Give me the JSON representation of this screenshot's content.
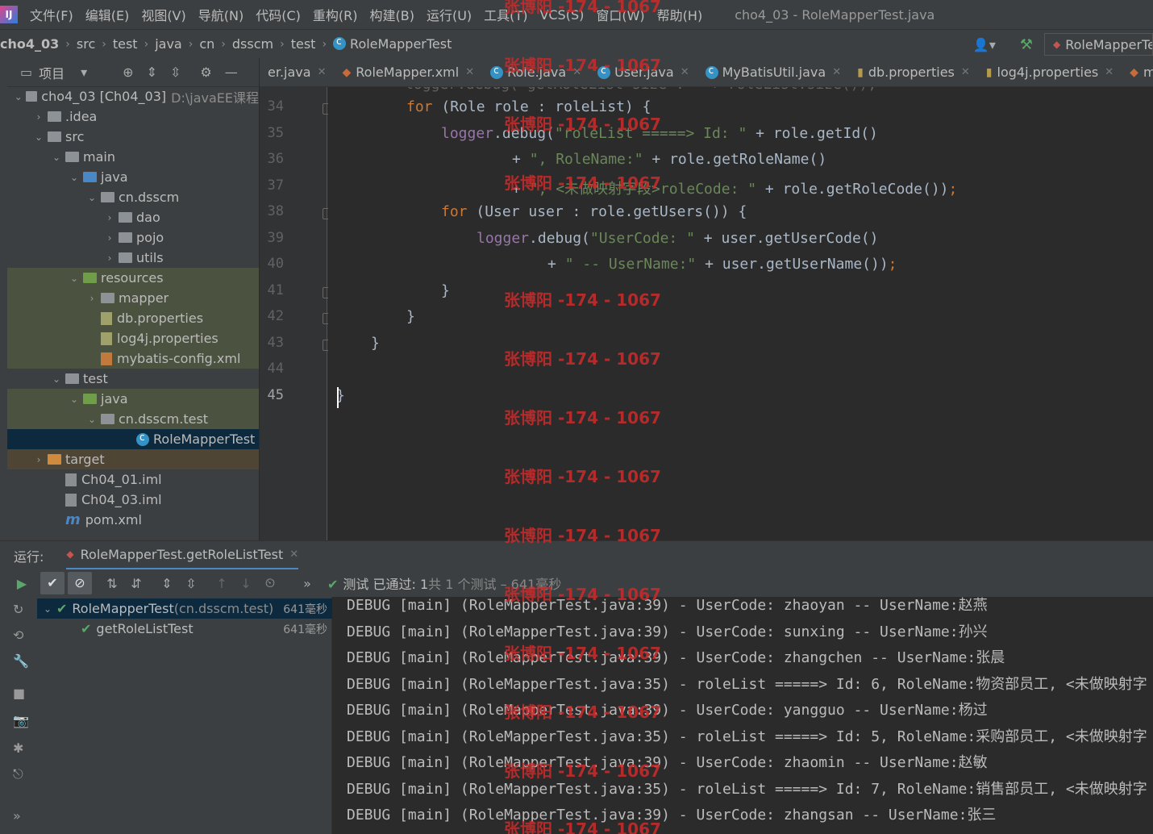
{
  "menubar": {
    "logo": "IJ",
    "items": [
      "文件(F)",
      "编辑(E)",
      "视图(V)",
      "导航(N)",
      "代码(C)",
      "重构(R)",
      "构建(B)",
      "运行(U)",
      "工具(T)",
      "VCS(S)",
      "窗口(W)",
      "帮助(H)"
    ],
    "window_title": "cho4_03 - RoleMapperTest.java"
  },
  "breadcrumb": [
    "cho4_03",
    "src",
    "test",
    "java",
    "cn",
    "dsscm",
    "test",
    "RoleMapperTest"
  ],
  "nav_right": {
    "run_config": "RoleMapperTest"
  },
  "project_panel": {
    "title": "项目",
    "tree": [
      {
        "label": "cho4_03 [Ch04_03]",
        "extra": "D:\\javaEE课程",
        "indent": 0,
        "twist": "⌄",
        "icon": "folder",
        "style": ""
      },
      {
        "label": ".idea",
        "indent": 1,
        "twist": "›",
        "icon": "folder",
        "style": ""
      },
      {
        "label": "src",
        "indent": 1,
        "twist": "⌄",
        "icon": "folder",
        "style": ""
      },
      {
        "label": "main",
        "indent": 2,
        "twist": "⌄",
        "icon": "folder",
        "style": ""
      },
      {
        "label": "java",
        "indent": 3,
        "twist": "⌄",
        "icon": "folder blue",
        "style": ""
      },
      {
        "label": "cn.dsscm",
        "indent": 4,
        "twist": "⌄",
        "icon": "folder",
        "style": ""
      },
      {
        "label": "dao",
        "indent": 5,
        "twist": "›",
        "icon": "folder",
        "style": ""
      },
      {
        "label": "pojo",
        "indent": 5,
        "twist": "›",
        "icon": "folder",
        "style": ""
      },
      {
        "label": "utils",
        "indent": 5,
        "twist": "›",
        "icon": "folder",
        "style": ""
      },
      {
        "label": "resources",
        "indent": 3,
        "twist": "⌄",
        "icon": "folder green",
        "style": "hl"
      },
      {
        "label": "mapper",
        "indent": 4,
        "twist": "›",
        "icon": "folder",
        "style": "hl"
      },
      {
        "label": "db.properties",
        "indent": 4,
        "twist": "",
        "icon": "file-ic prop",
        "style": "hl"
      },
      {
        "label": "log4j.properties",
        "indent": 4,
        "twist": "",
        "icon": "file-ic prop",
        "style": "hl"
      },
      {
        "label": "mybatis-config.xml",
        "indent": 4,
        "twist": "",
        "icon": "file-ic xml",
        "style": "hl"
      },
      {
        "label": "test",
        "indent": 2,
        "twist": "⌄",
        "icon": "folder",
        "style": ""
      },
      {
        "label": "java",
        "indent": 3,
        "twist": "⌄",
        "icon": "folder green",
        "style": "hl"
      },
      {
        "label": "cn.dsscm.test",
        "indent": 4,
        "twist": "⌄",
        "icon": "folder",
        "style": "hl"
      },
      {
        "label": "RoleMapperTest",
        "indent": 6,
        "twist": "",
        "icon": "class",
        "style": "sel"
      },
      {
        "label": "target",
        "indent": 1,
        "twist": "›",
        "icon": "folder orange",
        "style": "tgt"
      },
      {
        "label": "Ch04_01.iml",
        "indent": 2,
        "twist": "",
        "icon": "file-ic",
        "style": ""
      },
      {
        "label": "Ch04_03.iml",
        "indent": 2,
        "twist": "",
        "icon": "file-ic",
        "style": ""
      },
      {
        "label": "pom.xml",
        "indent": 2,
        "twist": "",
        "icon": "maven",
        "style": ""
      }
    ]
  },
  "tabs": [
    {
      "label": "er.java",
      "icon": "none",
      "active": false
    },
    {
      "label": "RoleMapper.xml",
      "icon": "xml",
      "active": false
    },
    {
      "label": "Role.java",
      "icon": "class",
      "active": false
    },
    {
      "label": "User.java",
      "icon": "class",
      "active": false
    },
    {
      "label": "MyBatisUtil.java",
      "icon": "class",
      "active": false
    },
    {
      "label": "db.properties",
      "icon": "prop",
      "active": false
    },
    {
      "label": "log4j.properties",
      "icon": "prop",
      "active": false
    },
    {
      "label": "my",
      "icon": "xml",
      "active": false
    }
  ],
  "editor": {
    "line_numbers": [
      "34",
      "35",
      "36",
      "37",
      "38",
      "39",
      "40",
      "41",
      "42",
      "43",
      "44",
      "45"
    ],
    "current_line": "45"
  },
  "run_panel": {
    "label": "运行:",
    "tab": "RoleMapperTest.getRoleListTest",
    "status_main": "测试 已通过: 1",
    "status_rest": "共 1 个测试 – 641毫秒",
    "test_tree": [
      {
        "name": "RoleMapperTest",
        "pkg": " (cn.dsscm.test)",
        "time": "641毫秒"
      },
      {
        "name": "getRoleListTest",
        "pkg": "",
        "time": "641毫秒"
      }
    ],
    "console": [
      "DEBUG [main] (RoleMapperTest.java:39) - UserCode: zhaoyan -- UserName:赵燕",
      "DEBUG [main] (RoleMapperTest.java:39) - UserCode: sunxing -- UserName:孙兴",
      "DEBUG [main] (RoleMapperTest.java:39) - UserCode: zhangchen -- UserName:张晨",
      "DEBUG [main] (RoleMapperTest.java:35) - roleList =====> Id: 6, RoleName:物资部员工, <未做映射字",
      "DEBUG [main] (RoleMapperTest.java:39) - UserCode: yangguo -- UserName:杨过",
      "DEBUG [main] (RoleMapperTest.java:35) - roleList =====> Id: 5, RoleName:采购部员工, <未做映射字",
      "DEBUG [main] (RoleMapperTest.java:39) - UserCode: zhaomin -- UserName:赵敏",
      "DEBUG [main] (RoleMapperTest.java:35) - roleList =====> Id: 7, RoleName:销售部员工, <未做映射字",
      "DEBUG [main] (RoleMapperTest.java:39) - UserCode: zhangsan -- UserName:张三"
    ]
  },
  "watermark": "张博阳 -174 - 1067"
}
